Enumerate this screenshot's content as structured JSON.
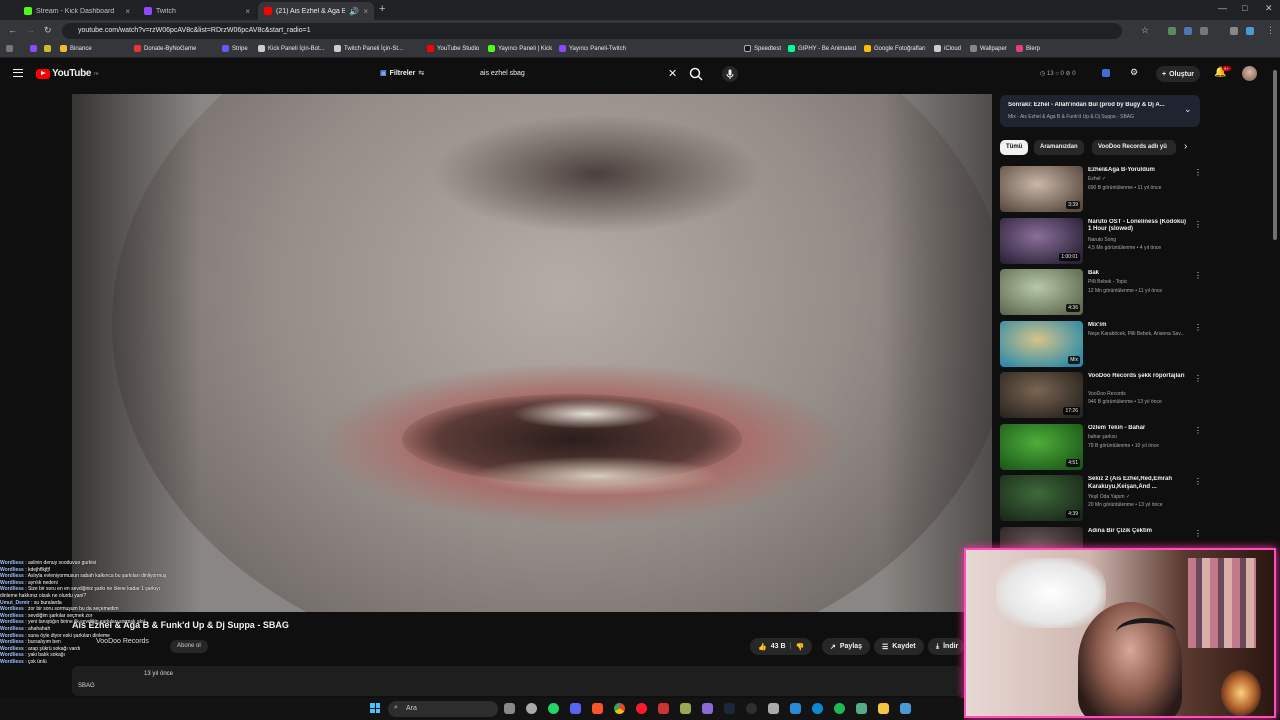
{
  "browser": {
    "tabs": [
      {
        "label": "Stream - Kick Dashboard",
        "color": "#53fc18"
      },
      {
        "label": "Twitch",
        "color": "#9146ff"
      },
      {
        "label": "(21) Ais Ezhel & Aga B & Fu",
        "color": "#ff0000"
      }
    ],
    "url": "youtube.com/watch?v=rzW06pcAV8c&list=RDrzW06pcAV8c&start_radio=1",
    "bookmarks": [
      "Binance",
      "Donate-ByNoGame",
      "Stripe",
      "Kick Paneli İçin-Bot...",
      "Twitch Paneli İçin-St...",
      "YouTube Studio",
      "Yayıncı Paneli | Kick",
      "Yayıncı Paneli-Twitch",
      "Speedtest",
      "GIPHY - Be Animated",
      "Google Fotoğrafları",
      "iCloud",
      "Wallpaper",
      "Blerp"
    ]
  },
  "youtube": {
    "logo": "YouTube",
    "logo_suffix": "TR",
    "filters_label": "Filtreler",
    "search_value": "ais ezhel sbag",
    "stats": "◷ 13  ○ 0  ⊘ 0",
    "create_label": "Oluştur",
    "notif_badge": "9+"
  },
  "video": {
    "title": "Ais Ezhel & Aga B & Funk'd Up & Dj Suppa - SBAG",
    "channel": "VooDoo Records",
    "subscribe_label": "Abone ol",
    "likes": "43 B",
    "share_label": "Paylaş",
    "save_label": "Kaydet",
    "download_label": "İndir",
    "desc_meta": "13 yıl önce",
    "desc_text": "SBAG"
  },
  "chat": [
    {
      "user": "Wordliess",
      "msg": "aslinin denuy sooduvuo gurkisi"
    },
    {
      "user": "Wordliess",
      "msg": "kdejhflkjfjf"
    },
    {
      "user": "Wordliess",
      "msg": "Aslıyla evleniyormusun sabah kalkınca bu şarkıları dinliyormuş"
    },
    {
      "user": "Wordliess",
      "msg": "ayrılık nedeni"
    },
    {
      "user": "Wordliess",
      "msg": "Size bir soru en en sevdiğiniz şarkı ne ölene kadar 1 şarkıyı"
    },
    {
      "user": "",
      "msg": "dinleme hakkınız olsak ne olurdu yani?"
    },
    {
      "user": "Umut_Demir",
      "msg": "su buralarda"
    },
    {
      "user": "Wordliess",
      "msg": "zor bir soru sormuşum bu da seçemedim"
    },
    {
      "user": "Wordliess",
      "msg": "sevdiğim şarkılar seçmek zor"
    },
    {
      "user": "Wordliess",
      "msg": "yeni tanıştığın birine ilk sevdiğin şarkıları sormak akıl"
    },
    {
      "user": "Wordliess",
      "msg": "ahahahah"
    },
    {
      "user": "Wordliess",
      "msg": "suna öyle diyor eski şarkıları dinleme"
    },
    {
      "user": "Wordliess",
      "msg": "bursalıyım ben"
    },
    {
      "user": "Wordliess",
      "msg": "arap şükrü sokağı vardı"
    },
    {
      "user": "Wordliess",
      "msg": "yaki balık sokağı"
    },
    {
      "user": "Wordliess",
      "msg": "çok ünlü"
    }
  ],
  "sidebar": {
    "up_next": "Sonraki: Ezhel - Allah'ından Bul (prod by Bugy & Dj A...",
    "up_next_sub": "Mix - Ais Ezhel & Aga B & Funk'd Up & Dj Suppa - SBAG",
    "chips": [
      "Tümü",
      "Aramanızdan",
      "VooDoo Records adlı yü"
    ],
    "recs": [
      {
        "title": "Ezhel&Aga B-Yoruldum",
        "channel": "Ezhel ✓",
        "meta": "690 B görüntülenme • 11 yıl önce",
        "duration": "3:39",
        "c1": "#c9b8a8",
        "c2": "#5a4a40"
      },
      {
        "title": "Naruto OST - Loneliness (Kodoku) 1 Hour (slowed)",
        "channel": "Naruto Song",
        "meta": "4,5 Mn görüntülenme • 4 yıl önce",
        "duration": "1:00:01",
        "c1": "#8a6f9a",
        "c2": "#2b2238"
      },
      {
        "title": "Bak",
        "channel": "Pilli Bebek - Topic",
        "meta": "12 Mn görüntülenme • 11 yıl önce",
        "duration": "4:36",
        "c1": "#b7c9a8",
        "c2": "#5f6a50"
      },
      {
        "title": "Mix'im",
        "channel": "Neşe Karaböcek, Pilli Bebek, Arianna Sav...",
        "meta": "",
        "duration": "Mix",
        "c1": "#d7c48a",
        "c2": "#2a8aa8"
      },
      {
        "title": "VooDoo Records şəkk röportajları",
        "channel": "VooDoo Records",
        "meta": "946 B görüntülenme • 13 yıl önce",
        "duration": "17:26",
        "c1": "#7a6552",
        "c2": "#2a2520"
      },
      {
        "title": "Özlem Tekin - Bahar",
        "channel": "bahar şarkısı",
        "meta": "79 B görüntülenme • 10 yıl önce",
        "duration": "4:51",
        "c1": "#4fae3a",
        "c2": "#1d5a1a"
      },
      {
        "title": "Sekiz 2 (Ais Ezhel,Red,Emrah Karakuyu,Keişan,And ...",
        "channel": "Yeşil Oda Yapım ✓",
        "meta": "20 Mn görüntülenme • 13 yıl önce",
        "duration": "4:39",
        "c1": "#3e6a3a",
        "c2": "#1a2a1a"
      },
      {
        "title": "Adına Bir Çizik Çektim",
        "channel": "",
        "meta": "",
        "duration": "",
        "c1": "#6a5a5a",
        "c2": "#2a2020"
      }
    ]
  },
  "taskbar": {
    "search_label": "Ara"
  },
  "colors": {
    "accent": "#ff0000",
    "cam_border": "#ff4fb8"
  }
}
